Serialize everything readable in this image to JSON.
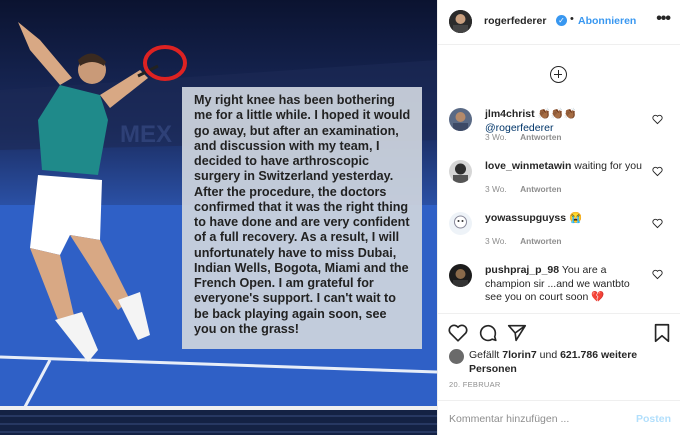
{
  "post": {
    "caption": "My right knee has been bothering me for a little while. I hoped it would go away, but after an examination, and discussion with my team, I decided to have arthroscopic surgery in Switzerland yesterday. After the procedure, the doctors confirmed that it was the right thing to have done and are very confident of a full recovery. As a result, I will unfortunately have to miss Dubai, Indian Wells, Bogota, Miami and the French Open. I am grateful for everyone's support. I can't wait to be back playing again soon, see you on the grass!"
  },
  "header": {
    "username": "rogerfederer",
    "separator": "•",
    "follow_label": "Abonnieren",
    "more_label": "•••"
  },
  "comments": [
    {
      "username": "jlm4christ",
      "text": "👏🏾👏🏾👏🏾 ",
      "mention": "@rogerfederer",
      "time": "3 Wo.",
      "reply": "Antworten"
    },
    {
      "username": "love_winmetawin",
      "text": "waiting for you",
      "time": "3 Wo.",
      "reply": "Antworten"
    },
    {
      "username": "yowassupguyss",
      "text": "😭",
      "time": "3 Wo.",
      "reply": "Antworten"
    },
    {
      "username": "pushpraj_p_98",
      "text": "You are a champion sir ...and we wantbto see you on court soon 💔",
      "time": "",
      "reply": ""
    }
  ],
  "likes": {
    "prefix": "Gefällt",
    "user": "7lorin7",
    "connector": "und",
    "count": "621.786 weitere Personen"
  },
  "date": "20. FEBRUAR",
  "add_comment": {
    "placeholder": "Kommentar hinzufügen ...",
    "post_label": "Posten"
  },
  "icons": [
    "heart-icon",
    "comment-icon",
    "share-icon",
    "bookmark-icon",
    "plus-circle-icon",
    "verified-icon"
  ],
  "colors": {
    "accent": "#3897f0",
    "court": "#2d62c8",
    "text": "#262626",
    "muted": "#8e8e8e"
  }
}
